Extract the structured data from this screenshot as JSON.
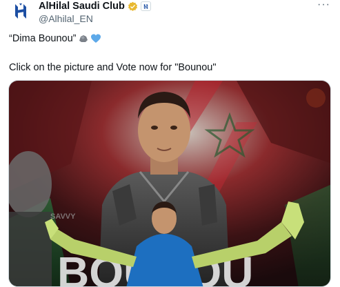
{
  "tweet": {
    "display_name": "AlHilal Saudi Club",
    "handle": "@Alhilal_EN",
    "more_label": "···",
    "text_line1": "“Dima Bounou”",
    "text_line2": "Click on the picture and Vote now for \"Bounou\"",
    "emojis": [
      "rock-icon",
      "blue-heart-icon"
    ]
  },
  "media": {
    "alt": "Yassine Bounou goalkeeper graphic",
    "jersey_letters": "BOUNOU",
    "shirt_text": "SAVVY"
  },
  "colors": {
    "brand_blue": "#1d4fa3",
    "verified_gold": "#e8b830",
    "text_secondary": "#536471",
    "poster_red": "#9e1b24"
  }
}
